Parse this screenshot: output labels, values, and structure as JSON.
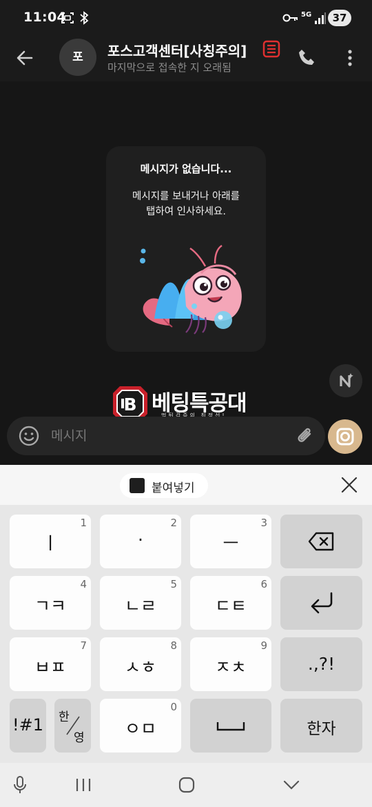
{
  "status_bar": {
    "time": "11:04",
    "network": "5G",
    "battery": "37"
  },
  "header": {
    "avatar_initial": "포",
    "name": "포스고객센터[사칭주의]",
    "subtitle": "마지막으로 접속한 지 오래됨",
    "badge_color": "#e03030"
  },
  "empty_state": {
    "title": "메시지가 없습니다...",
    "body_line1": "메시지를 보내거나 아래를",
    "body_line2": "탭하여 인사하세요.",
    "sticker_icon": "shrimp-sticker"
  },
  "watermark": {
    "title": "베팅특공대",
    "subtitle": "먹튀검증의 최정선!"
  },
  "input": {
    "placeholder": "메시지"
  },
  "accent_color": "#d8b88e",
  "clipboard": {
    "paste_label": "붙여넣기"
  },
  "keyboard": {
    "rows": [
      [
        {
          "label": "ㅣ",
          "num": "1"
        },
        {
          "label": "·",
          "num": "2"
        },
        {
          "label": "ㅡ",
          "num": "3"
        },
        {
          "label": "",
          "icon": "backspace-icon"
        }
      ],
      [
        {
          "label": "ㄱㅋ",
          "num": "4"
        },
        {
          "label": "ㄴㄹ",
          "num": "5"
        },
        {
          "label": "ㄷㅌ",
          "num": "6"
        },
        {
          "label": "",
          "icon": "enter-icon"
        }
      ],
      [
        {
          "label": "ㅂㅍ",
          "num": "7"
        },
        {
          "label": "ㅅㅎ",
          "num": "8"
        },
        {
          "label": "ㅈㅊ",
          "num": "9"
        },
        {
          "label": ".,?!"
        }
      ],
      [
        {
          "label": "!#1"
        },
        {
          "label_top": "한",
          "label_bottom": "영"
        },
        {
          "label": "ㅇㅁ",
          "num": "0"
        },
        {
          "label": "",
          "icon": "space-icon"
        },
        {
          "label": "한자"
        }
      ]
    ]
  }
}
